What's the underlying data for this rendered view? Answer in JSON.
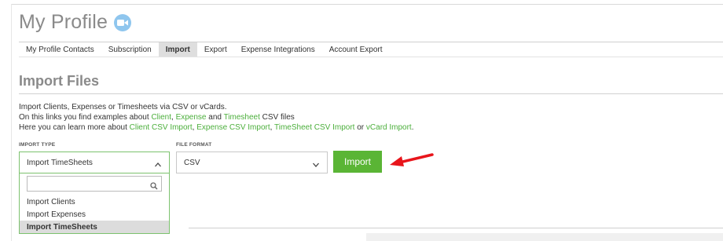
{
  "page": {
    "title": "My Profile",
    "section_title": "Import Files"
  },
  "tabs": [
    {
      "label": "My Profile Contacts",
      "active": false
    },
    {
      "label": "Subscription",
      "active": false
    },
    {
      "label": "Import",
      "active": true
    },
    {
      "label": "Export",
      "active": false
    },
    {
      "label": "Expense Integrations",
      "active": false
    },
    {
      "label": "Account Export",
      "active": false
    }
  ],
  "info": {
    "line1": "Import Clients, Expenses or Timesheets via CSV or vCards.",
    "line2_prefix": "On this links you find examples about ",
    "line2_link_client": "Client",
    "line2_sep1": ", ",
    "line2_link_expense": "Expense",
    "line2_sep2": " and ",
    "line2_link_timesheet": "Timesheet",
    "line2_suffix": " CSV files",
    "line3_prefix": "Here you can learn more about ",
    "line3_link_client_csv": "Client CSV Import",
    "line3_sep1": ", ",
    "line3_link_expense_csv": "Expense CSV Import",
    "line3_sep2": ", ",
    "line3_link_timesheet_csv": "TimeSheet CSV Import",
    "line3_sep3": " or ",
    "line3_link_vcard": "vCard Import",
    "line3_suffix": "."
  },
  "form": {
    "import_type_label": "IMPORT TYPE",
    "import_type_value": "Import TimeSheets",
    "import_type_options": [
      "Import Clients",
      "Import Expenses",
      "Import TimeSheets"
    ],
    "selected_option": "Import TimeSheets",
    "search_value": "",
    "file_format_label": "FILE FORMAT",
    "file_format_value": "CSV",
    "import_button": "Import"
  },
  "colors": {
    "accent_green": "#5ab535",
    "link_green": "#4caf3c",
    "annotation_arrow": "#e8151b",
    "camera_icon": "#8fc6ee"
  },
  "icons": [
    "video-camera-icon",
    "chevron-up-icon",
    "chevron-down-icon",
    "search-icon",
    "annotation-arrow-icon"
  ]
}
